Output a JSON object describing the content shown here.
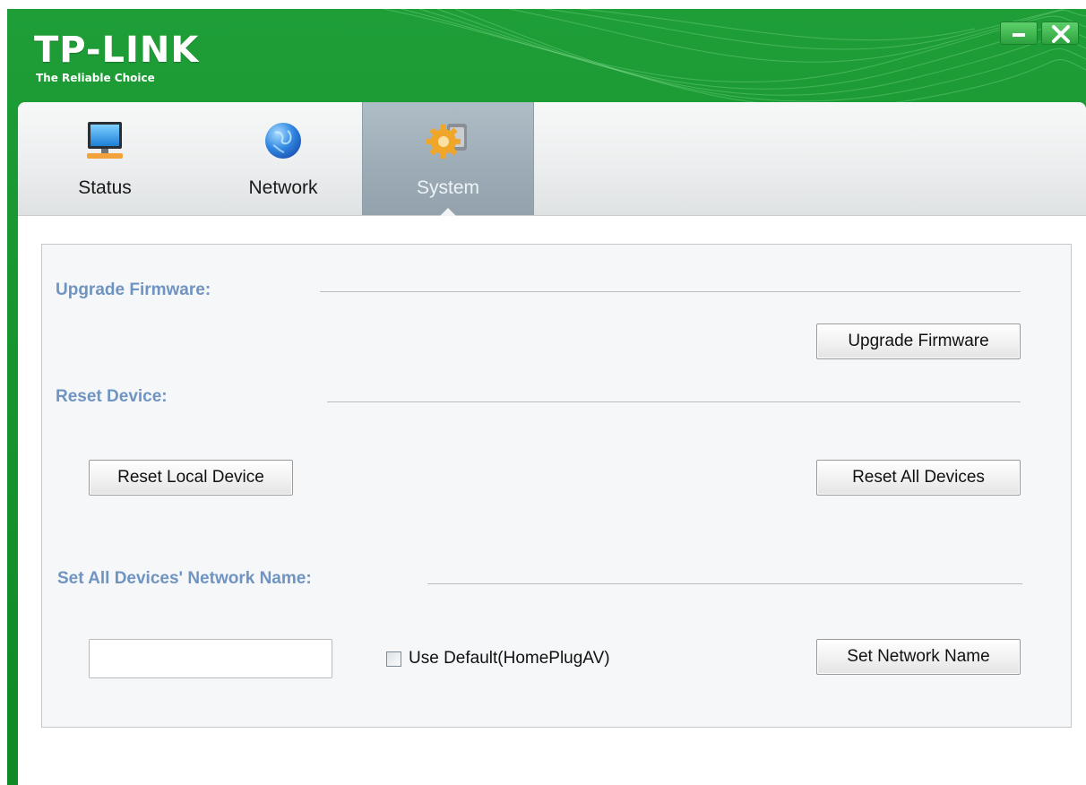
{
  "brand": {
    "name": "TP-LINK",
    "tagline": "The Reliable Choice"
  },
  "window_controls": {
    "minimize_icon": "minimize-icon",
    "close_icon": "close-icon"
  },
  "tabs": [
    {
      "label": "Status",
      "icon": "monitor-icon",
      "selected": false
    },
    {
      "label": "Network",
      "icon": "globe-icon",
      "selected": false
    },
    {
      "label": "System",
      "icon": "gear-icon",
      "selected": true
    }
  ],
  "sections": {
    "upgrade": {
      "title": "Upgrade Firmware:",
      "button_label": "Upgrade Firmware"
    },
    "reset": {
      "title": "Reset Device:",
      "local_button_label": "Reset Local Device",
      "all_button_label": "Reset All Devices"
    },
    "network_name": {
      "title": "Set All Devices' Network Name:",
      "input_value": "",
      "checkbox_label": "Use Default(HomePlugAV)",
      "checkbox_checked": false,
      "button_label": "Set Network Name"
    }
  },
  "colors": {
    "brand_green": "#17962f",
    "section_title": "#6f94c2",
    "selected_tab": "#9cabb5"
  }
}
